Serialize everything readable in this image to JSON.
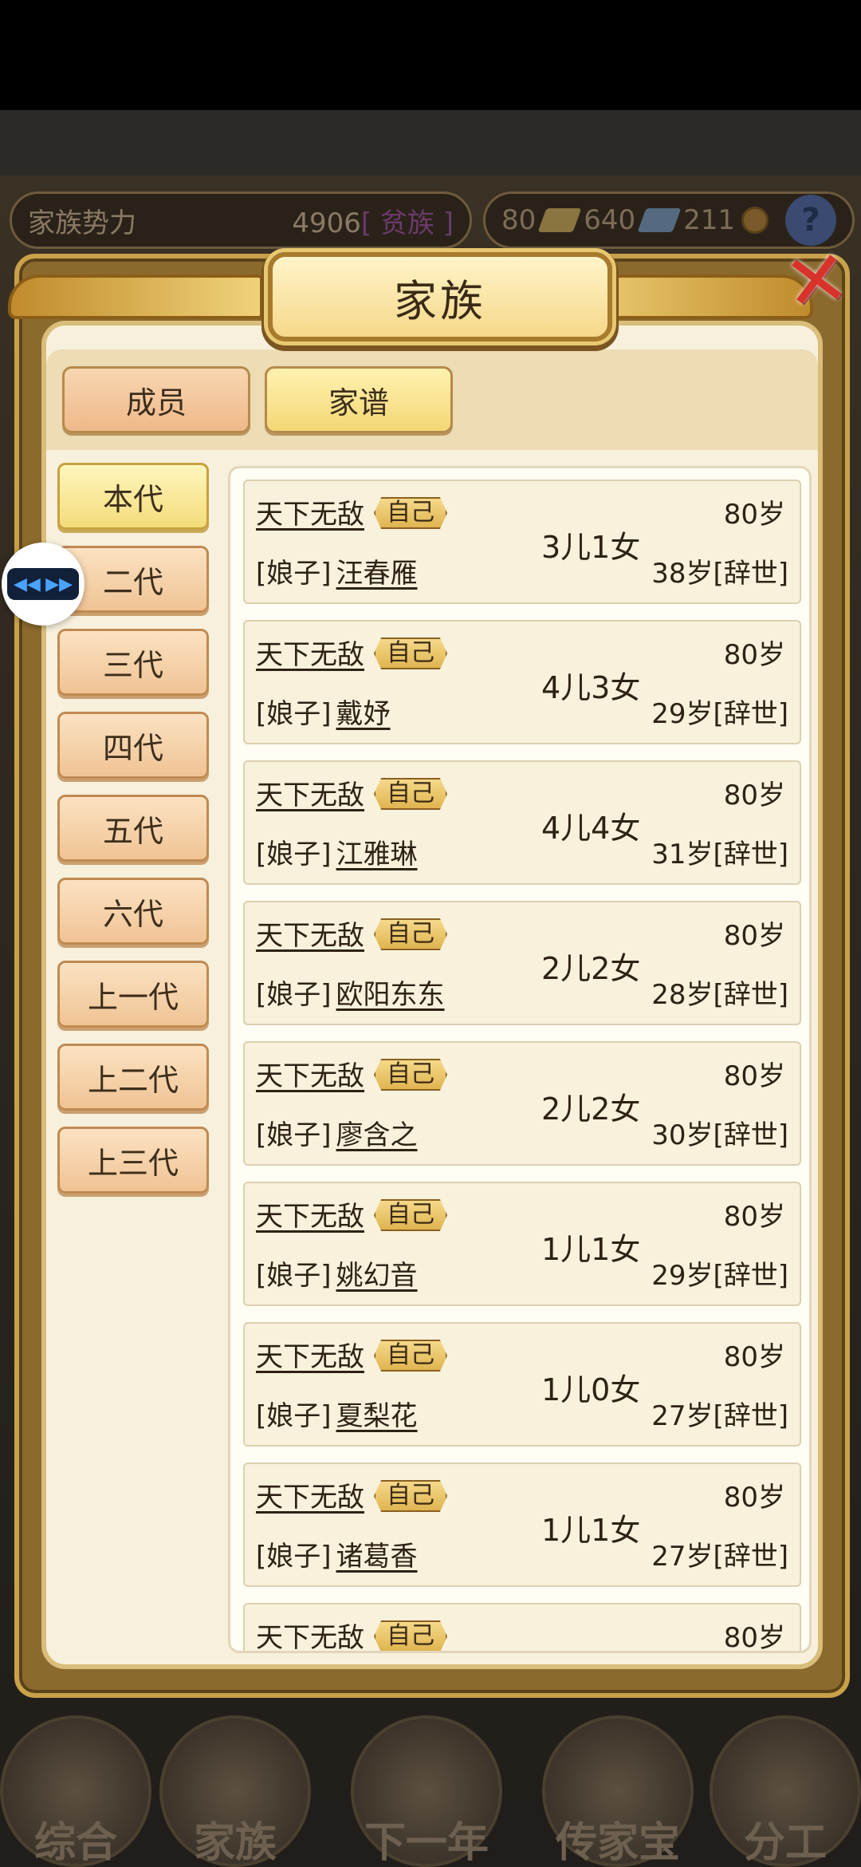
{
  "top_bar": {
    "power_label": "家族势力",
    "power_value": "4906",
    "power_rank": "[ 贫族 ]",
    "gold": "80",
    "silver": "640",
    "copper": "211",
    "help": "?"
  },
  "modal": {
    "title": "家族",
    "tabs": [
      {
        "label": "成员"
      },
      {
        "label": "家谱"
      }
    ],
    "generations": [
      {
        "label": "本代"
      },
      {
        "label": "二代"
      },
      {
        "label": "三代"
      },
      {
        "label": "四代"
      },
      {
        "label": "五代"
      },
      {
        "label": "六代"
      },
      {
        "label": "上一代"
      },
      {
        "label": "上二代"
      },
      {
        "label": "上三代"
      }
    ],
    "records": [
      {
        "name": "天下无敌",
        "tag": "自己",
        "age": "80岁",
        "spouse_prefix": "[娘子]",
        "spouse": "汪春雁",
        "children": "3儿1女",
        "spouse_age": "38岁[辞世]"
      },
      {
        "name": "天下无敌",
        "tag": "自己",
        "age": "80岁",
        "spouse_prefix": "[娘子]",
        "spouse": "戴妤",
        "children": "4儿3女",
        "spouse_age": "29岁[辞世]"
      },
      {
        "name": "天下无敌",
        "tag": "自己",
        "age": "80岁",
        "spouse_prefix": "[娘子]",
        "spouse": "江雅琳",
        "children": "4儿4女",
        "spouse_age": "31岁[辞世]"
      },
      {
        "name": "天下无敌",
        "tag": "自己",
        "age": "80岁",
        "spouse_prefix": "[娘子]",
        "spouse": "欧阳东东",
        "children": "2儿2女",
        "spouse_age": "28岁[辞世]"
      },
      {
        "name": "天下无敌",
        "tag": "自己",
        "age": "80岁",
        "spouse_prefix": "[娘子]",
        "spouse": "廖含之",
        "children": "2儿2女",
        "spouse_age": "30岁[辞世]"
      },
      {
        "name": "天下无敌",
        "tag": "自己",
        "age": "80岁",
        "spouse_prefix": "[娘子]",
        "spouse": "姚幻音",
        "children": "1儿1女",
        "spouse_age": "29岁[辞世]"
      },
      {
        "name": "天下无敌",
        "tag": "自己",
        "age": "80岁",
        "spouse_prefix": "[娘子]",
        "spouse": "夏梨花",
        "children": "1儿0女",
        "spouse_age": "27岁[辞世]"
      },
      {
        "name": "天下无敌",
        "tag": "自己",
        "age": "80岁",
        "spouse_prefix": "[娘子]",
        "spouse": "诸葛香",
        "children": "1儿1女",
        "spouse_age": "27岁[辞世]"
      },
      {
        "name": "天下无敌",
        "tag": "自己",
        "age": "80岁",
        "spouse_prefix": "",
        "spouse": "",
        "children": "",
        "spouse_age": ""
      }
    ]
  },
  "bottom_nav": [
    {
      "label": "综合"
    },
    {
      "label": "家族"
    },
    {
      "label": "下一年"
    },
    {
      "label": "传家宝"
    },
    {
      "label": "分工"
    }
  ]
}
